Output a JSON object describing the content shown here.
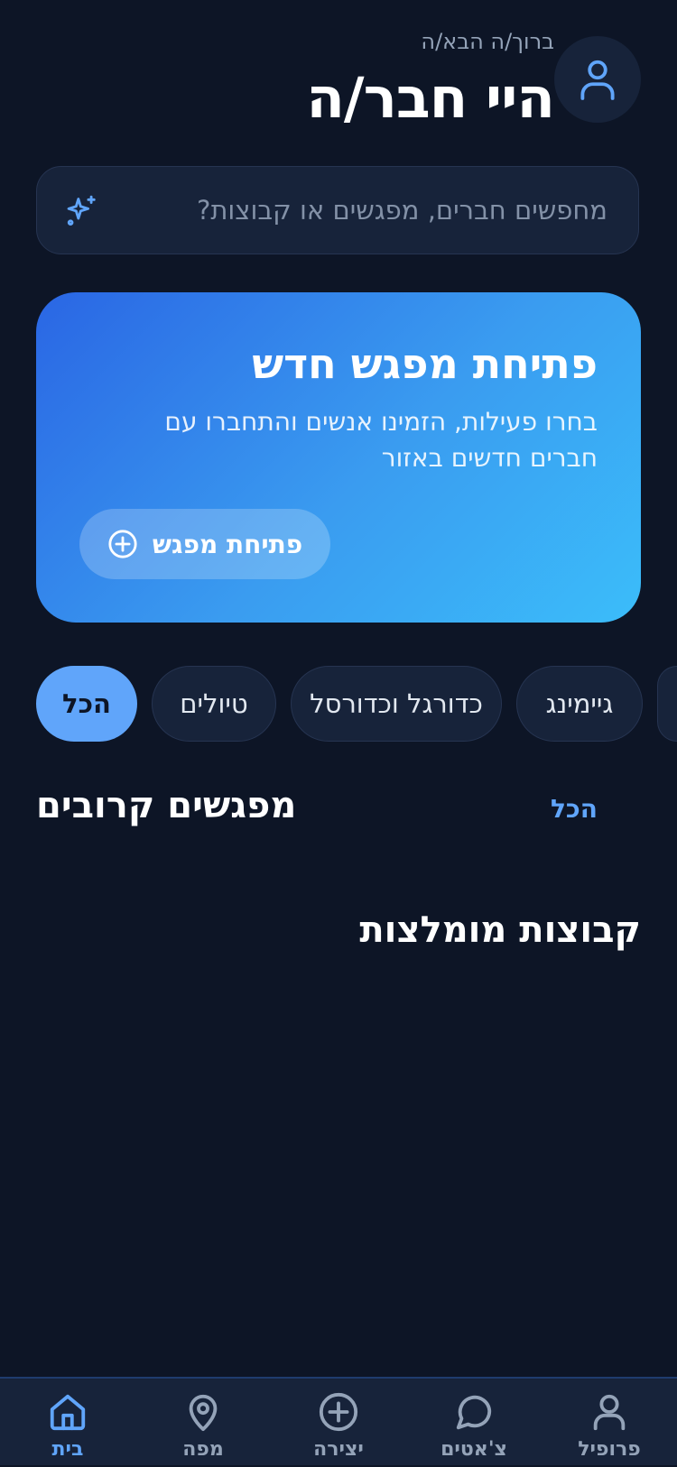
{
  "header": {
    "greeting": "ברוך/ה הבא/ה",
    "title": "היי חבר/ה"
  },
  "search": {
    "placeholder": "מחפשים חברים, מפגשים או קבוצות?"
  },
  "promo": {
    "title": "פתיחת מפגש חדש",
    "description": "בחרו פעילות, הזמינו אנשים והתחברו עם חברים חדשים באזור",
    "button_label": "פתיחת מפגש"
  },
  "categories": [
    {
      "label": "הכל",
      "active": true
    },
    {
      "label": "טיולים",
      "active": false
    },
    {
      "label": "כדורגל וכדורסל",
      "active": false
    },
    {
      "label": "גיימינג",
      "active": false
    }
  ],
  "nearby": {
    "title": "מפגשים קרובים",
    "see_all": "הכל"
  },
  "recommended": {
    "title": "קבוצות מומלצות"
  },
  "bottom_nav": [
    {
      "label": "בית",
      "icon": "home-icon",
      "active": true
    },
    {
      "label": "מפה",
      "icon": "map-pin-icon",
      "active": false
    },
    {
      "label": "יצירה",
      "icon": "plus-circle-icon",
      "active": false
    },
    {
      "label": "צ'אטים",
      "icon": "chat-bubble-icon",
      "active": false
    },
    {
      "label": "פרופיל",
      "icon": "user-icon",
      "active": false
    }
  ],
  "colors": {
    "background": "#0d1526",
    "surface": "#17233a",
    "accent": "#60a5fa",
    "gradient_start": "#2a66e4",
    "gradient_end": "#3bbdfa"
  }
}
